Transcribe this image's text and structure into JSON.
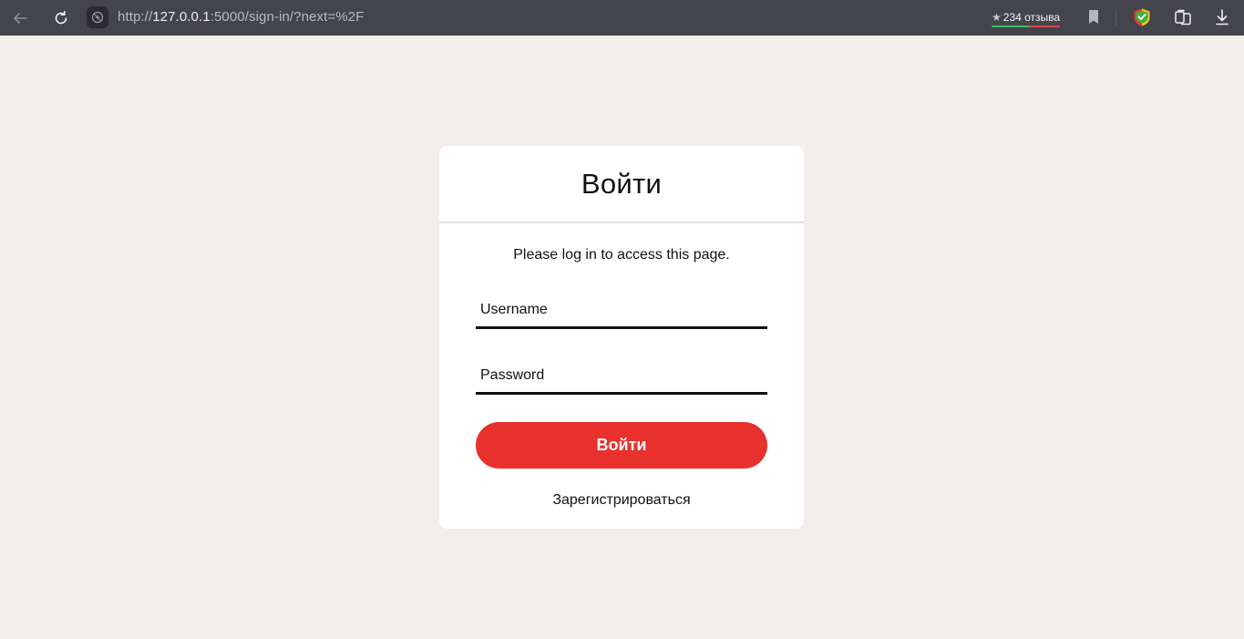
{
  "browser": {
    "url_scheme": "http://",
    "url_host": "127.0.0.1",
    "url_rest": ":5000/sign-in/?next=%2F",
    "reviews_label": "234 отзыва"
  },
  "login": {
    "title": "Войти",
    "notice": "Please log in to access this page.",
    "username_placeholder": "Username",
    "password_placeholder": "Password",
    "submit_label": "Войти",
    "register_link": "Зарегистрироваться"
  },
  "colors": {
    "page_background": "#f2efea",
    "browser_bar": "#44444c",
    "accent": "#e8302c"
  }
}
